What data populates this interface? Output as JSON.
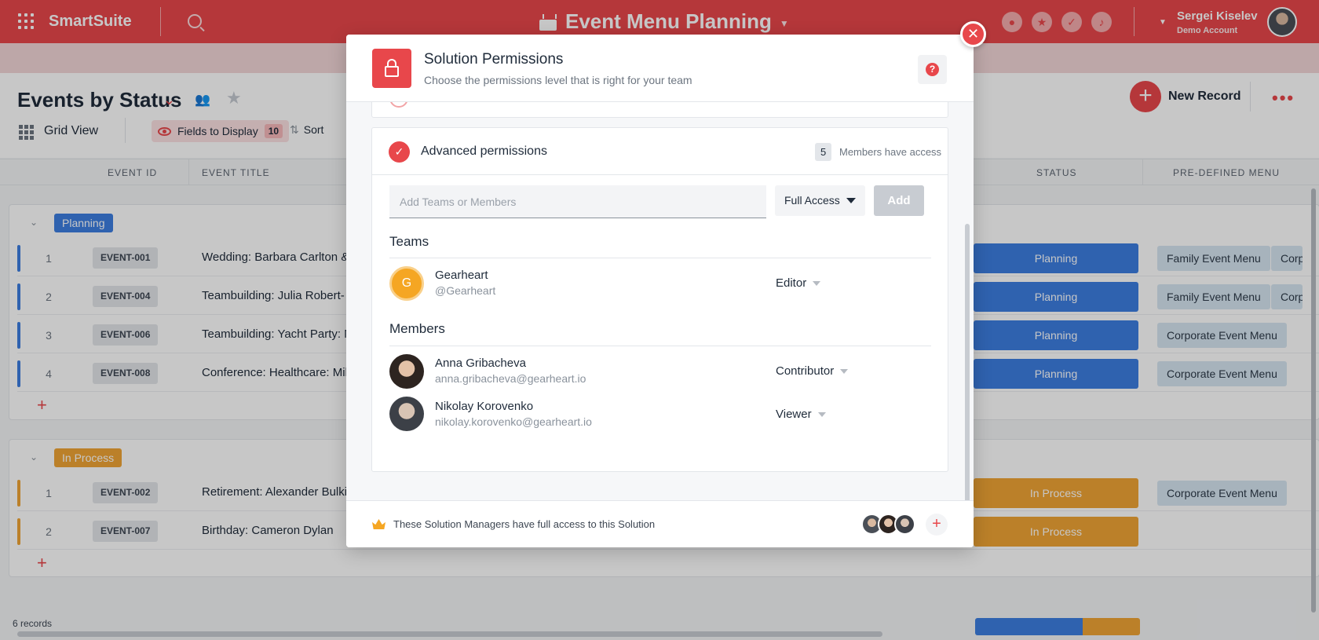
{
  "topbar": {
    "brand": "SmartSuite",
    "app_title": "Event Menu Planning",
    "user_name": "Sergei Kiselev",
    "user_sub": "Demo Account",
    "icons": [
      "members-icon",
      "star-icon",
      "check-icon",
      "bell-icon"
    ]
  },
  "header": {
    "view_title": "Events by Status",
    "view_type": "Grid View",
    "fields_label": "Fields to Display",
    "fields_count": "10",
    "sort_label": "Sort",
    "new_record_label": "New Record"
  },
  "columns": [
    "EVENT ID",
    "EVENT TITLE",
    "STATUS",
    "PRE-DEFINED MENU"
  ],
  "groups": [
    {
      "label": "Planning",
      "color": "#3d7ee0",
      "rows": [
        {
          "num": "1",
          "id": "EVENT-001",
          "title": "Wedding: Barbara Carlton & ",
          "status": "Planning",
          "menus": [
            "Family Event Menu",
            "Corp"
          ]
        },
        {
          "num": "2",
          "id": "EVENT-004",
          "title": "Teambuilding: Julia Robert-",
          "status": "Planning",
          "menus": [
            "Family Event Menu",
            "Corp"
          ]
        },
        {
          "num": "3",
          "id": "EVENT-006",
          "title": "Teambuilding: Yacht Party: N",
          "status": "Planning",
          "menus": [
            "Corporate Event Menu"
          ]
        },
        {
          "num": "4",
          "id": "EVENT-008",
          "title": "Conference: Healthcare: Mil",
          "status": "Planning",
          "menus": [
            "Corporate Event Menu"
          ]
        }
      ]
    },
    {
      "label": "In Process",
      "color": "#f0a535",
      "rows": [
        {
          "num": "1",
          "id": "EVENT-002",
          "title": "Retirement: Alexander Bulki",
          "status": "In Process",
          "menus": [
            "Corporate Event Menu"
          ]
        },
        {
          "num": "2",
          "id": "EVENT-007",
          "title": "Birthday: Cameron Dylan",
          "status": "In Process",
          "menus": []
        }
      ]
    }
  ],
  "footer": {
    "records": "6 records"
  },
  "modal": {
    "title": "Solution Permissions",
    "subtitle": "Choose the permissions level that is right for your team",
    "advanced_title": "Advanced permissions",
    "members_count": "5",
    "members_access_label": "Members have access",
    "input_placeholder": "Add Teams or Members",
    "access_level": "Full Access",
    "add_label": "Add",
    "teams_title": "Teams",
    "members_title": "Members",
    "teams": [
      {
        "initial": "G",
        "name": "Gearheart",
        "handle": "@Gearheart",
        "role": "Editor"
      }
    ],
    "members": [
      {
        "name": "Anna Gribacheva",
        "email": "anna.gribacheva@gearheart.io",
        "role": "Contributor"
      },
      {
        "name": "Nikolay Korovenko",
        "email": "nikolay.korovenko@gearheart.io",
        "role": "Viewer"
      }
    ],
    "footer_text": "These Solution Managers have full access to this Solution"
  },
  "colors": {
    "accent": "#e8474b",
    "planning": "#3d7ee0",
    "in_process": "#f0a535"
  }
}
